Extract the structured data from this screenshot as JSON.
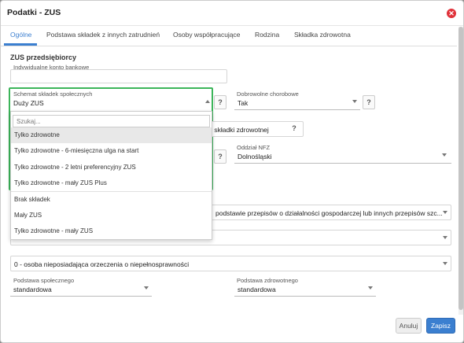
{
  "dialog": {
    "title": "Podatki - ZUS",
    "close_icon": "close-icon"
  },
  "tabs": [
    {
      "label": "Ogólne",
      "active": true
    },
    {
      "label": "Podstawa składek z innych zatrudnień"
    },
    {
      "label": "Osoby współpracujące"
    },
    {
      "label": "Rodzina"
    },
    {
      "label": "Składka zdrowotna"
    }
  ],
  "section": {
    "title": "ZUS przedsiębiorcy"
  },
  "bank_account": {
    "label": "Indywidualne konto bankowe",
    "value": ""
  },
  "schemat": {
    "label": "Schemat składek społecznych",
    "value": "Duży ZUS"
  },
  "chorobowe": {
    "label": "Dobrowolne chorobowe",
    "value": "Tak"
  },
  "help_glyph": "?",
  "zdrowotna_partial": "ze składki zdrowotnej",
  "nfz": {
    "label": "Oddział NFZ",
    "value": "Dolnośląski"
  },
  "przepisy_partial": "podstawie przepisów o działalności gospodarczej lub innych przepisów szc...",
  "dropdown": {
    "search_placeholder": "Szukaj...",
    "options": [
      "Tylko zdrowotne",
      "Tylko zdrowotne - 6-miesięczna ulga na start",
      "Tylko zdrowotne - 2 letni preferencyjny ZUS",
      "Tylko zdrowotne - mały ZUS Plus",
      "Brak składek",
      "Mały ZUS",
      "Tylko zdrowotne - mały ZUS"
    ]
  },
  "disability": {
    "value": "0 - osoba nieposiadająca orzeczenia o niepełnosprawności"
  },
  "podstawa_spol": {
    "label": "Podstawa społecznego",
    "value": "standardowa"
  },
  "podstawa_zdrow": {
    "label": "Podstawa zdrowotnego",
    "value": "standardowa"
  },
  "footer": {
    "cancel_label": "Anuluj",
    "save_label": "Zapisz"
  },
  "colors": {
    "accent": "#3b7fd0",
    "focus": "#3cb55a",
    "close": "#e0323a"
  }
}
